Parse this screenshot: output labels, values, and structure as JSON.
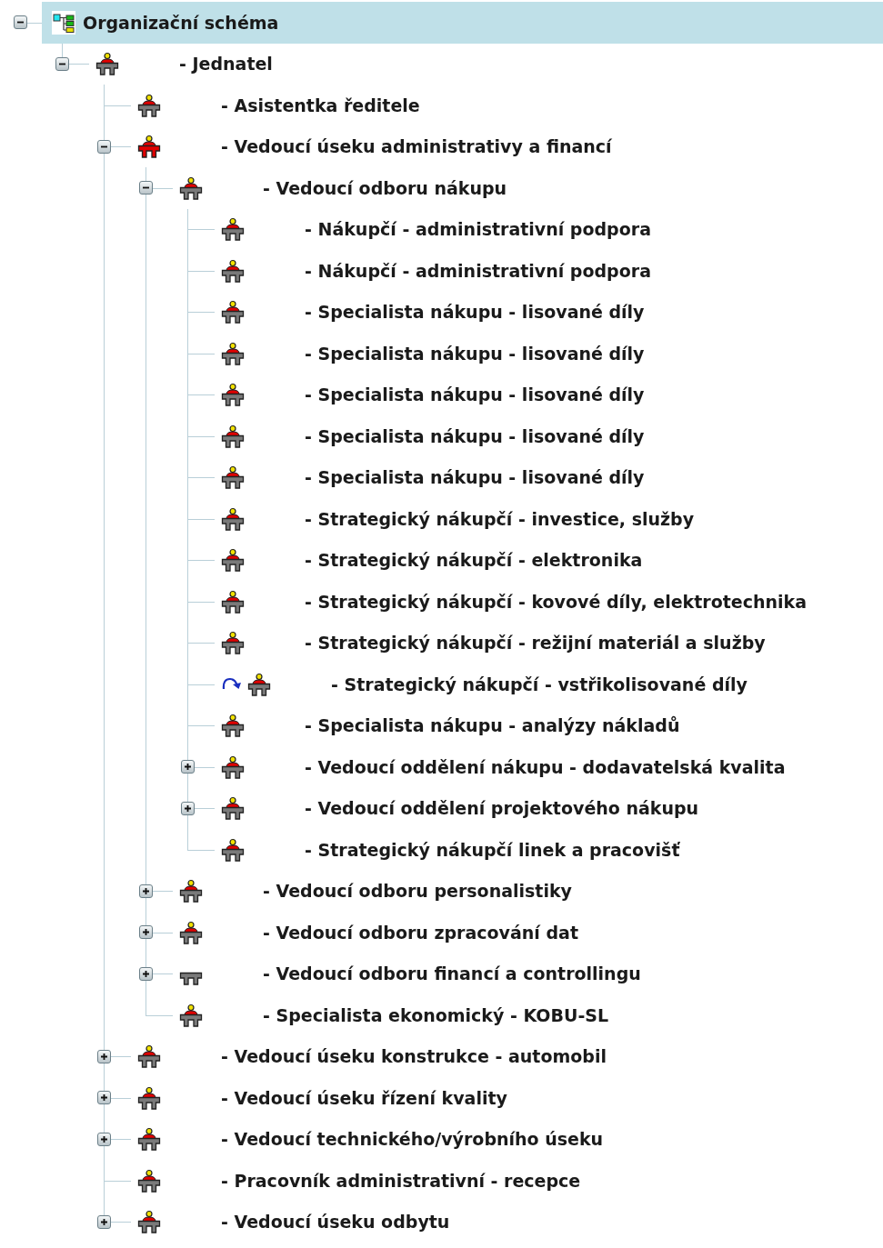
{
  "tree": {
    "label": "Organizační schéma",
    "kind": "org-chart",
    "selected": true,
    "expanded": true,
    "children": [
      {
        "label": "- Jednatel",
        "kind": "occupied",
        "selected": false,
        "expanded": true,
        "children": [
          {
            "label": "- Asistentka ředitele",
            "kind": "occupied",
            "selected": false
          },
          {
            "label": "- Vedoucí úseku administrativy a financí",
            "kind": "highlighted",
            "selected": false,
            "expanded": true,
            "children": [
              {
                "label": "- Vedoucí odboru nákupu",
                "kind": "occupied",
                "selected": false,
                "expanded": true,
                "children": [
                  {
                    "label": "- Nákupčí - administrativní podpora",
                    "kind": "occupied",
                    "selected": false
                  },
                  {
                    "label": "- Nákupčí - administrativní podpora",
                    "kind": "occupied",
                    "selected": false
                  },
                  {
                    "label": "- Specialista nákupu - lisované díly",
                    "kind": "occupied",
                    "selected": false
                  },
                  {
                    "label": "- Specialista nákupu - lisované díly",
                    "kind": "occupied",
                    "selected": false
                  },
                  {
                    "label": "- Specialista nákupu - lisované díly",
                    "kind": "occupied",
                    "selected": false
                  },
                  {
                    "label": "- Specialista nákupu - lisované díly",
                    "kind": "occupied",
                    "selected": false
                  },
                  {
                    "label": "- Specialista nákupu - lisované díly",
                    "kind": "occupied",
                    "selected": false
                  },
                  {
                    "label": "- Strategický nákupčí - investice, služby",
                    "kind": "occupied",
                    "selected": false
                  },
                  {
                    "label": "- Strategický nákupčí - elektronika",
                    "kind": "occupied",
                    "selected": false
                  },
                  {
                    "label": "- Strategický nákupčí - kovové díly, elektrotechnika",
                    "kind": "occupied",
                    "selected": false
                  },
                  {
                    "label": "- Strategický nákupčí - režijní materiál a služby",
                    "kind": "occupied",
                    "selected": false
                  },
                  {
                    "label": "- Strategický nákupčí - vstřikolisované díly",
                    "kind": "linked",
                    "selected": false
                  },
                  {
                    "label": "- Specialista nákupu - analýzy nákladů",
                    "kind": "occupied",
                    "selected": false
                  },
                  {
                    "label": "- Vedoucí oddělení nákupu - dodavatelská kvalita",
                    "kind": "occupied",
                    "selected": false,
                    "expanded": false
                  },
                  {
                    "label": "- Vedoucí oddělení projektového nákupu",
                    "kind": "occupied",
                    "selected": false,
                    "expanded": false
                  },
                  {
                    "label": "- Strategický nákupčí linek a pracovišť",
                    "kind": "occupied",
                    "selected": false
                  }
                ]
              },
              {
                "label": "- Vedoucí odboru personalistiky",
                "kind": "occupied",
                "selected": false,
                "expanded": false
              },
              {
                "label": "- Vedoucí odboru zpracování dat",
                "kind": "occupied",
                "selected": false,
                "expanded": false
              },
              {
                "label": "- Vedoucí odboru financí a controllingu",
                "kind": "empty",
                "selected": false,
                "expanded": false
              },
              {
                "label": "- Specialista ekonomický - KOBU-SL",
                "kind": "occupied",
                "selected": false
              }
            ]
          },
          {
            "label": "- Vedoucí úseku konstrukce - automobil",
            "kind": "occupied",
            "selected": false,
            "expanded": false
          },
          {
            "label": "- Vedoucí úseku řízení kvality",
            "kind": "occupied",
            "selected": false,
            "expanded": false
          },
          {
            "label": "- Vedoucí technického/výrobního úseku",
            "kind": "occupied",
            "selected": false,
            "expanded": false
          },
          {
            "label": "- Pracovník administrativní - recepce",
            "kind": "occupied",
            "selected": false
          },
          {
            "label": "- Vedoucí úseku odbytu",
            "kind": "occupied",
            "selected": false,
            "expanded": false
          }
        ]
      }
    ]
  }
}
